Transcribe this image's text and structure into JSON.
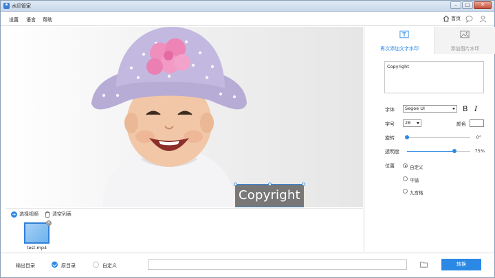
{
  "window": {
    "title": "水印管家",
    "buttons": {
      "minimize": "–",
      "maximize": "□",
      "close": "✕"
    }
  },
  "menu": {
    "settings": "设置",
    "language": "语言",
    "help": "帮助"
  },
  "topbar": {
    "home": "首页"
  },
  "preview": {
    "watermark_text": "Copyright"
  },
  "filebar": {
    "select_video": "选择视频",
    "clear_list": "清空列表",
    "files": [
      {
        "name": "test.mp4",
        "remove_label": "×"
      }
    ]
  },
  "panel": {
    "tab_text": "再次添加文字水印",
    "tab_image": "添加图片水印",
    "text_value": "Copyright",
    "font_label": "字体",
    "font_value": "Segoe UI",
    "bold_label": "B",
    "italic_label": "I",
    "size_label": "字号",
    "size_value": "28",
    "color_label": "颜色",
    "color_value": "#ffffff",
    "rotation_label": "旋转",
    "rotation_value": "0°",
    "rotation_level": 0,
    "opacity_label": "透明度",
    "opacity_value": "75%",
    "opacity_level": 0.75,
    "position_label": "位置",
    "position_options": [
      "自定义",
      "平铺",
      "九宫格"
    ],
    "position_selected": "自定义"
  },
  "bottom": {
    "output_label": "输出目录",
    "option_original": "原目录",
    "option_custom": "自定义",
    "selected": "原目录",
    "path_value": "",
    "convert_button": "转换"
  },
  "colors": {
    "accent": "#2b89e5",
    "selection": "#3a86d8"
  }
}
